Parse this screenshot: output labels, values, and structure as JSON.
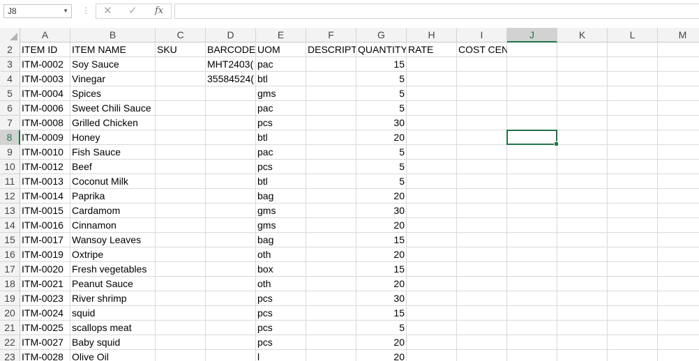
{
  "formula_bar": {
    "name_box": "J8",
    "cancel_icon": "✕",
    "enter_icon": "✓",
    "fx_label": "fx",
    "formula": ""
  },
  "columns": [
    "A",
    "B",
    "C",
    "D",
    "E",
    "F",
    "G",
    "H",
    "I",
    "J",
    "K",
    "L",
    "M"
  ],
  "selected_column": "J",
  "selected_row": "8",
  "headers": {
    "A": "ITEM ID",
    "B": "ITEM NAME",
    "C": "SKU",
    "D": "BARCODE",
    "E": "UOM",
    "F": "DESCRIPTI",
    "G": "QUANTITY",
    "H": "RATE",
    "I": "COST CENTER"
  },
  "rows": [
    {
      "row": "3",
      "id": "ITM-0002",
      "name": "Soy Sauce",
      "barcode": "MHT2403(",
      "uom": "pac",
      "qty": "15"
    },
    {
      "row": "4",
      "id": "ITM-0003",
      "name": "Vinegar",
      "barcode": "35584524(",
      "uom": "btl",
      "qty": "5"
    },
    {
      "row": "5",
      "id": "ITM-0004",
      "name": "Spices",
      "barcode": "",
      "uom": "gms",
      "qty": "5"
    },
    {
      "row": "6",
      "id": "ITM-0006",
      "name": "Sweet Chili Sauce",
      "barcode": "",
      "uom": "pac",
      "qty": "5"
    },
    {
      "row": "7",
      "id": "ITM-0008",
      "name": "Grilled Chicken",
      "barcode": "",
      "uom": "pcs",
      "qty": "30"
    },
    {
      "row": "8",
      "id": "ITM-0009",
      "name": "Honey",
      "barcode": "",
      "uom": "btl",
      "qty": "20"
    },
    {
      "row": "9",
      "id": "ITM-0010",
      "name": "Fish Sauce",
      "barcode": "",
      "uom": "pac",
      "qty": "5"
    },
    {
      "row": "10",
      "id": "ITM-0012",
      "name": "Beef",
      "barcode": "",
      "uom": "pcs",
      "qty": "5"
    },
    {
      "row": "11",
      "id": "ITM-0013",
      "name": "Coconut Milk",
      "barcode": "",
      "uom": "btl",
      "qty": "5"
    },
    {
      "row": "12",
      "id": "ITM-0014",
      "name": "Paprika",
      "barcode": "",
      "uom": "bag",
      "qty": "20"
    },
    {
      "row": "13",
      "id": "ITM-0015",
      "name": "Cardamom",
      "barcode": "",
      "uom": "gms",
      "qty": "30"
    },
    {
      "row": "14",
      "id": "ITM-0016",
      "name": "Cinnamon",
      "barcode": "",
      "uom": "gms",
      "qty": "20"
    },
    {
      "row": "15",
      "id": "ITM-0017",
      "name": "Wansoy Leaves",
      "barcode": "",
      "uom": "bag",
      "qty": "15"
    },
    {
      "row": "16",
      "id": "ITM-0019",
      "name": "Oxtripe",
      "barcode": "",
      "uom": "oth",
      "qty": "20"
    },
    {
      "row": "17",
      "id": "ITM-0020",
      "name": "Fresh vegetables",
      "barcode": "",
      "uom": "box",
      "qty": "15"
    },
    {
      "row": "18",
      "id": "ITM-0021",
      "name": "Peanut Sauce",
      "barcode": "",
      "uom": "oth",
      "qty": "20"
    },
    {
      "row": "19",
      "id": "ITM-0023",
      "name": "River shrimp",
      "barcode": "",
      "uom": "pcs",
      "qty": "30"
    },
    {
      "row": "20",
      "id": "ITM-0024",
      "name": "squid",
      "barcode": "",
      "uom": "pcs",
      "qty": "15"
    },
    {
      "row": "21",
      "id": "ITM-0025",
      "name": "scallops meat",
      "barcode": "",
      "uom": "pcs",
      "qty": "5"
    },
    {
      "row": "22",
      "id": "ITM-0027",
      "name": "Baby squid",
      "barcode": "",
      "uom": "pcs",
      "qty": "20"
    },
    {
      "row": "23",
      "id": "ITM-0028",
      "name": "Olive Oil",
      "barcode": "",
      "uom": "l",
      "qty": "20"
    }
  ],
  "colors": {
    "accent": "#217346",
    "header_bg": "#f3f3f3",
    "gridline": "#d9d9d9"
  }
}
